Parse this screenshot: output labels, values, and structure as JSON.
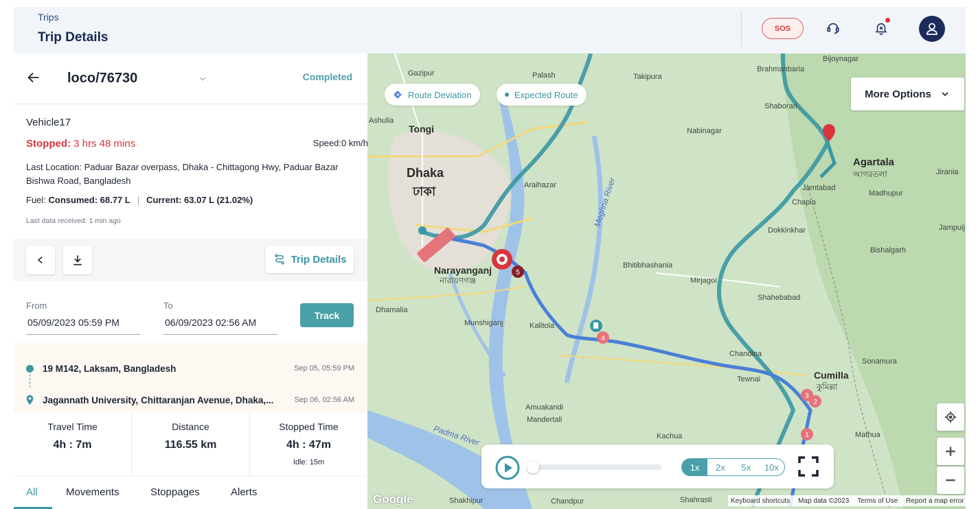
{
  "header": {
    "breadcrumb": "Trips",
    "title": "Trip Details",
    "sos_label": "SOS"
  },
  "trip": {
    "id": "loco/76730",
    "status": "Completed",
    "vehicle": "Vehicle17",
    "stopped_label": "Stopped:",
    "stopped_value": "3 hrs 48 mins",
    "speed_label": "Speed:",
    "speed_value": "0 km/h",
    "location_label": "Last Location:",
    "location_value": "Paduar Bazar overpass, Dhaka - Chittagong Hwy, Paduar Bazar Bishwa Road, Bangladesh",
    "fuel_label": "Fuel:",
    "fuel_consumed": "Consumed: 68.77 L",
    "fuel_current": "Current: 63.07 L (21.02%)",
    "last_data": "Last data received: 1 min ago"
  },
  "actions": {
    "trip_details_label": "Trip Details"
  },
  "dates": {
    "from_label": "From",
    "from_value": "05/09/2023 05:59 PM",
    "to_label": "To",
    "to_value": "06/09/2023 02:56 AM",
    "track_label": "Track"
  },
  "route": {
    "start_name": "19 M142, Laksam, Bangladesh",
    "start_time": "Sep 05, 05:59 PM",
    "end_name": "Jagannath University, Chittaranjan Avenue, Dhaka,...",
    "end_time": "Sep 06, 02:56 AM"
  },
  "stats": {
    "travel_label": "Travel Time",
    "travel_value": "4h : 7m",
    "distance_label": "Distance",
    "distance_value": "116.55 km",
    "stopped_label": "Stopped Time",
    "stopped_value": "4h : 47m",
    "idle": "Idle: 15m"
  },
  "tabs": [
    "All",
    "Movements",
    "Stoppages",
    "Alerts"
  ],
  "map": {
    "legend_deviation": "Route Deviation",
    "legend_expected": "Expected Route",
    "more_options": "More Options",
    "speeds": [
      "1x",
      "2x",
      "5x",
      "10x"
    ],
    "active_speed": "1x",
    "playback_progress": 0.0,
    "google": "Google",
    "attribution": [
      "Keyboard shortcuts",
      "Map data ©2023",
      "Terms of Use",
      "Report a map error"
    ],
    "labels": {
      "dhaka": "Dhaka",
      "dhaka_bn": "ঢাকা",
      "narayanganj": "Narayanganj",
      "narayanganj_bn": "নারায়ণগঞ্জ",
      "agartala": "Agartala",
      "agartala_bn": "আগরতলা",
      "cumilla": "Cumilla",
      "cumilla_bn": "কুমিল্লা",
      "tongi": "Tongi",
      "takipura": "Takipura",
      "palash": "Palash",
      "gazipur": "Gazipur",
      "araihazar": "Araihazar",
      "munshiganj": "Munshiganj",
      "bhitibhashania": "Bhitibhashania",
      "mirjagor": "Mirjagor",
      "shahebabad": "Shahebabad",
      "nabinagar": "Nabinagar",
      "madhupur": "Madhupur",
      "bishalgarh": "Bishalgarh",
      "chapia": "Chapia",
      "chandina": "Chandina",
      "tewnai": "Tewnai",
      "sonamura": "Sonamura",
      "kachua": "Kachua",
      "mathua": "Mathua",
      "amuakandi": "Amuakandi",
      "mandertali": "Mandertali",
      "shahrasti": "Shahrasti",
      "chandpur": "Chandpur",
      "shakhipur": "Shakhipur",
      "dhamalia": "Dhamalia",
      "kalitola": "Kalitola",
      "bijoynagar": "Bijoynagar",
      "brahmanbaria": "Brahmanbaria",
      "shaborari": "Shaborari",
      "jamtabad": "Jamtabad",
      "dokkinkhar": "Dokkinkhar",
      "ashulia": "Ashulia",
      "jirania": "Jirania",
      "jampui": "Jampuij",
      "padma_river": "Padma River",
      "meghna_river": "Meghna River"
    },
    "markers": [
      "1",
      "2",
      "3",
      "4",
      "5"
    ]
  }
}
